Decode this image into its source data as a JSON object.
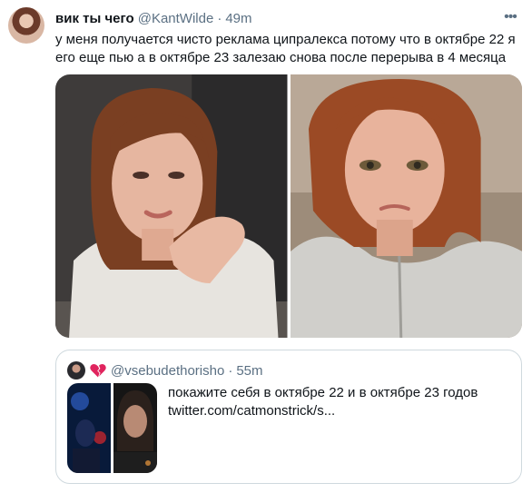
{
  "tweet": {
    "author_name": "вик ты чего",
    "author_handle": "@KantWilde",
    "separator": "·",
    "time": "49m",
    "text": "у меня получается чисто реклама ципралекса потому что в октябре 22 я его еще пью а в октябре 23 залезаю снова после перерыва в 4 месяца",
    "more_icon": "more-icon"
  },
  "quote": {
    "author_handle": "@vsebudethorisho",
    "separator": "·",
    "time": "55m",
    "badge_icon": "broken-heart-icon",
    "text": "покажите себя в октябре 22 и в октябре 23 годов",
    "link": "twitter.com/catmonstrick/s..."
  },
  "colors": {
    "text": "#0f1419",
    "secondary": "#5b7083",
    "border": "#cfd9de",
    "broken_heart": "#e0245e"
  }
}
